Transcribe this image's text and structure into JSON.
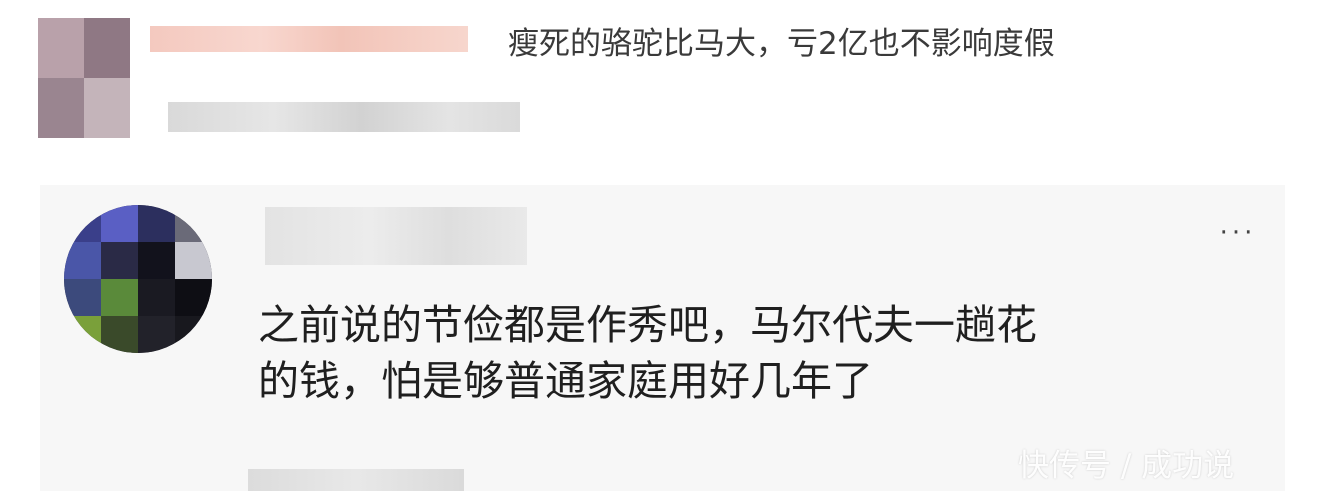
{
  "comments": [
    {
      "text": "瘦死的骆驼比马大，亏2亿也不影响度假"
    },
    {
      "text_line1": "之前说的节俭都是作秀吧，马尔代夫一趟花",
      "text_line2": "的钱，怕是够普通家庭用好几年了",
      "more_icon": "ellipsis-icon"
    }
  ],
  "watermark": {
    "text": "快传号 / 成功说"
  },
  "colors": {
    "card_bg": "#f7f7f7",
    "page_bg": "#ffffff",
    "text_primary": "#1f1f1f",
    "text_secondary": "#3a3a3a"
  }
}
